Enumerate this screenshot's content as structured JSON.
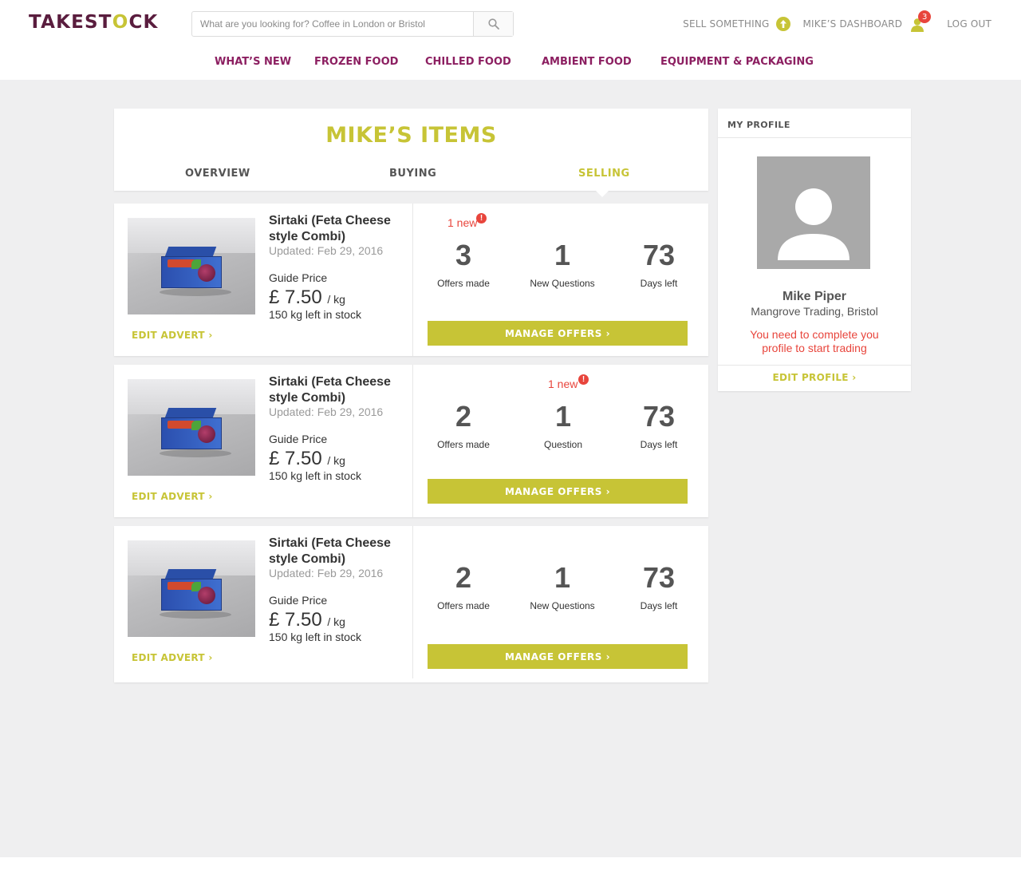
{
  "brand": {
    "logo_prefix": "TAKEST",
    "logo_o": "O",
    "logo_suffix": "CK",
    "primary_color": "#5a1d3e",
    "accent_color": "#c7c436",
    "nav_color": "#8c1f61",
    "alert_color": "#e8453c"
  },
  "search": {
    "placeholder": "What are you looking for? Coffee in London or Bristol",
    "icon": "search-icon"
  },
  "top_links": {
    "sell": "SELL SOMETHING",
    "sell_icon": "up-arrow-circle-icon",
    "dashboard": "MIKE’S DASHBOARD",
    "dashboard_icon": "user-icon",
    "notification_count": "3",
    "logout": "LOG OUT"
  },
  "nav": [
    "WHAT’S NEW",
    "FROZEN FOOD",
    "CHILLED FOOD",
    "AMBIENT FOOD",
    "EQUIPMENT & PACKAGING"
  ],
  "items_header": {
    "title": "MIKE’S ITEMS",
    "tabs": [
      "OVERVIEW",
      "BUYING",
      "SELLING"
    ],
    "active_tab": "SELLING"
  },
  "listings": [
    {
      "title": "Sirtaki (Feta Cheese style Combi)",
      "updated": "Updated: Feb 29, 2016",
      "guide_label": "Guide Price",
      "price": "£ 7.50",
      "unit": "/ kg",
      "stock": "150 kg left in stock",
      "edit_label": "EDIT ADVERT ›",
      "new_flag": "1 new",
      "stats": [
        {
          "value": "3",
          "label": "Offers made"
        },
        {
          "value": "1",
          "label": "New Questions"
        },
        {
          "value": "73",
          "label": "Days left"
        }
      ],
      "manage_label": "MANAGE OFFERS ›"
    },
    {
      "title": "Sirtaki (Feta Cheese style Combi)",
      "updated": "Updated: Feb 29, 2016",
      "guide_label": "Guide Price",
      "price": "£ 7.50",
      "unit": "/ kg",
      "stock": "150 kg left in stock",
      "edit_label": "EDIT ADVERT ›",
      "new_flag": "1 new",
      "stats": [
        {
          "value": "2",
          "label": "Offers made"
        },
        {
          "value": "1",
          "label": "Question"
        },
        {
          "value": "73",
          "label": "Days left"
        }
      ],
      "manage_label": "MANAGE OFFERS ›"
    },
    {
      "title": "Sirtaki (Feta Cheese style Combi)",
      "updated": "Updated: Feb 29, 2016",
      "guide_label": "Guide Price",
      "price": "£ 7.50",
      "unit": "/ kg",
      "stock": "150 kg left in stock",
      "edit_label": "EDIT ADVERT ›",
      "new_flag": "",
      "stats": [
        {
          "value": "2",
          "label": "Offers made"
        },
        {
          "value": "1",
          "label": "New Questions"
        },
        {
          "value": "73",
          "label": "Days left"
        }
      ],
      "manage_label": "MANAGE OFFERS ›"
    }
  ],
  "profile": {
    "heading": "MY PROFILE",
    "name": "Mike Piper",
    "company": "Mangrove Trading, Bristol",
    "warning": "You need to complete you profile to start trading",
    "edit_label": "EDIT PROFILE ›",
    "avatar_icon": "user-silhouette-icon"
  }
}
